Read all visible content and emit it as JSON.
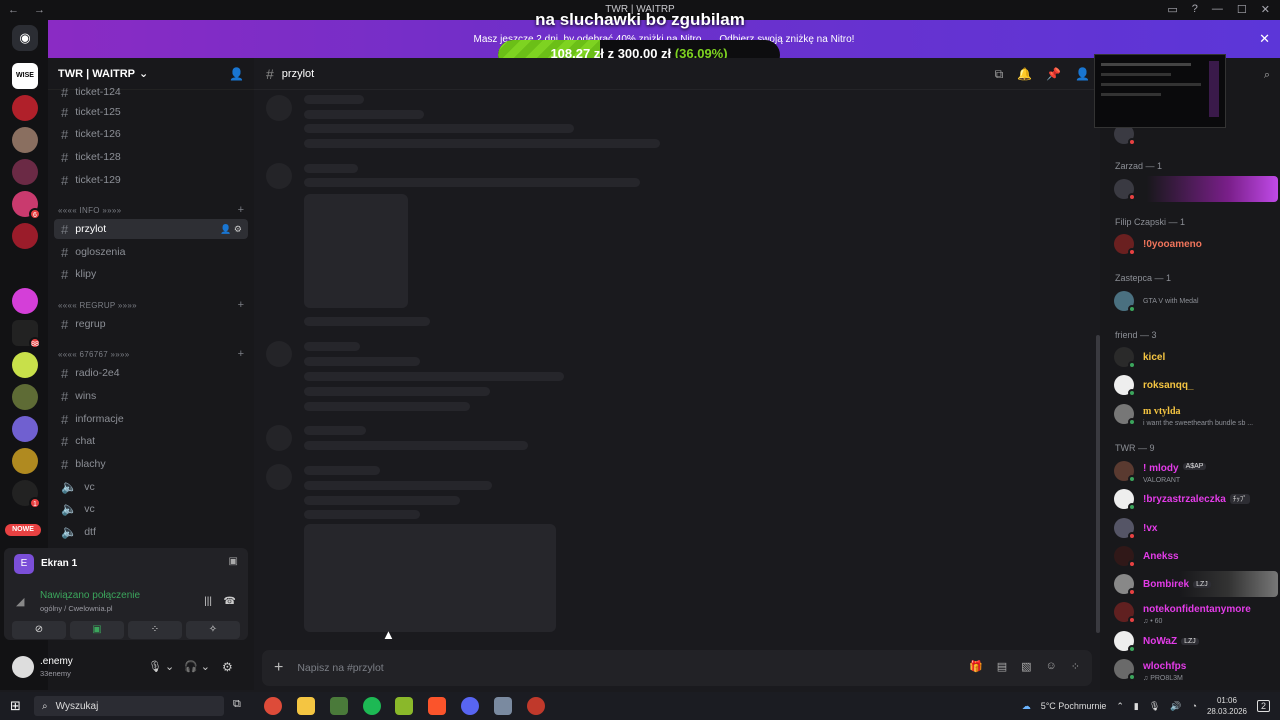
{
  "window": {
    "title": "TWR | WAITRP",
    "nav": "← →"
  },
  "overlay": {
    "text": "na sluchawki bo zgubilam",
    "raised": "108,27 zł",
    "goal_joiner": "z",
    "goal": "300,00 zł",
    "percent": "(36.09%)",
    "fill_fraction": 0.3609
  },
  "banner": {
    "left_text": "Masz jeszcze 2 dni, by odebrać 40% zniżki na Nitro",
    "cta": "Odbierz swoją zniżkę na Nitro!"
  },
  "rail": {
    "nowe": "NOWE"
  },
  "guild": {
    "name": "TWR | WAITRP"
  },
  "channels": {
    "top": [
      "ticket-124",
      "ticket-125",
      "ticket-126",
      "ticket-128",
      "ticket-129"
    ],
    "cat_info": "«««« INFO »»»»",
    "info": [
      "przylot",
      "ogloszenia",
      "klipy"
    ],
    "cat_regrup": "«««« REGRUP »»»»",
    "regrup": [
      "regrup"
    ],
    "cat_676767": "«««« 676767 »»»»",
    "g676767": [
      "radio-2e4",
      "wins",
      "informacje",
      "chat",
      "blachy"
    ],
    "voice": [
      "vc",
      "vc",
      "dtf"
    ]
  },
  "voice_panel": {
    "screen": "Ekran 1",
    "status": "Nawiązano połączenie",
    "server": "ogólny / Cwelownia.pl"
  },
  "user": {
    "name": ".enemy",
    "tag": "33enemy"
  },
  "main": {
    "channel": "przylot",
    "placeholder": "Napisz na #przylot"
  },
  "members": {
    "groups": [
      {
        "title": "Zarzad — 1",
        "items": [
          {
            "name": "",
            "color": "#c84cff",
            "sub": ""
          }
        ]
      },
      {
        "title": "Filip Czapski — 1",
        "items": [
          {
            "name": "!0yooameno",
            "color": "#f0745b",
            "sub": ""
          }
        ]
      },
      {
        "title": "Zastepca — 1",
        "items": [
          {
            "name": "",
            "color": "#ffffff",
            "sub": "GTA V with Medal"
          }
        ]
      },
      {
        "title": "friend — 3",
        "items": [
          {
            "name": "kicel",
            "color": "#f5c542",
            "sub": ""
          },
          {
            "name": "roksanqq_",
            "color": "#f5c542",
            "sub": ""
          },
          {
            "name": "m vtylda",
            "color": "#f5c542",
            "sub": "i want the sweethearth bundle sb ..."
          }
        ]
      },
      {
        "title": "TWR — 9",
        "items": [
          {
            "name": "! mlody",
            "color": "#e33ce8",
            "sub": "VALORANT",
            "tag": "A$AP"
          },
          {
            "name": "!bryzastrzaleczka",
            "color": "#e33ce8",
            "sub": "",
            "tag": "ﾁｯﾌﾟ"
          },
          {
            "name": "!vx",
            "color": "#e33ce8",
            "sub": ""
          },
          {
            "name": "Anekss",
            "color": "#e33ce8",
            "sub": ""
          },
          {
            "name": "Bombirek",
            "color": "#e33ce8",
            "sub": "",
            "tag": "LZJ"
          },
          {
            "name": "notekonfidentanymore",
            "color": "#e33ce8",
            "sub": "♫ • 60"
          },
          {
            "name": "NoWaZ",
            "color": "#e33ce8",
            "sub": "",
            "tag": "LZJ"
          },
          {
            "name": "wlochfps",
            "color": "#e33ce8",
            "sub": "♫ PRO8L3M"
          }
        ]
      }
    ]
  },
  "taskbar": {
    "search": "Wyszukaj",
    "weather": "5°C  Pochmurnie",
    "time": "01:06",
    "date": "28.03.2026",
    "notif": "2"
  }
}
